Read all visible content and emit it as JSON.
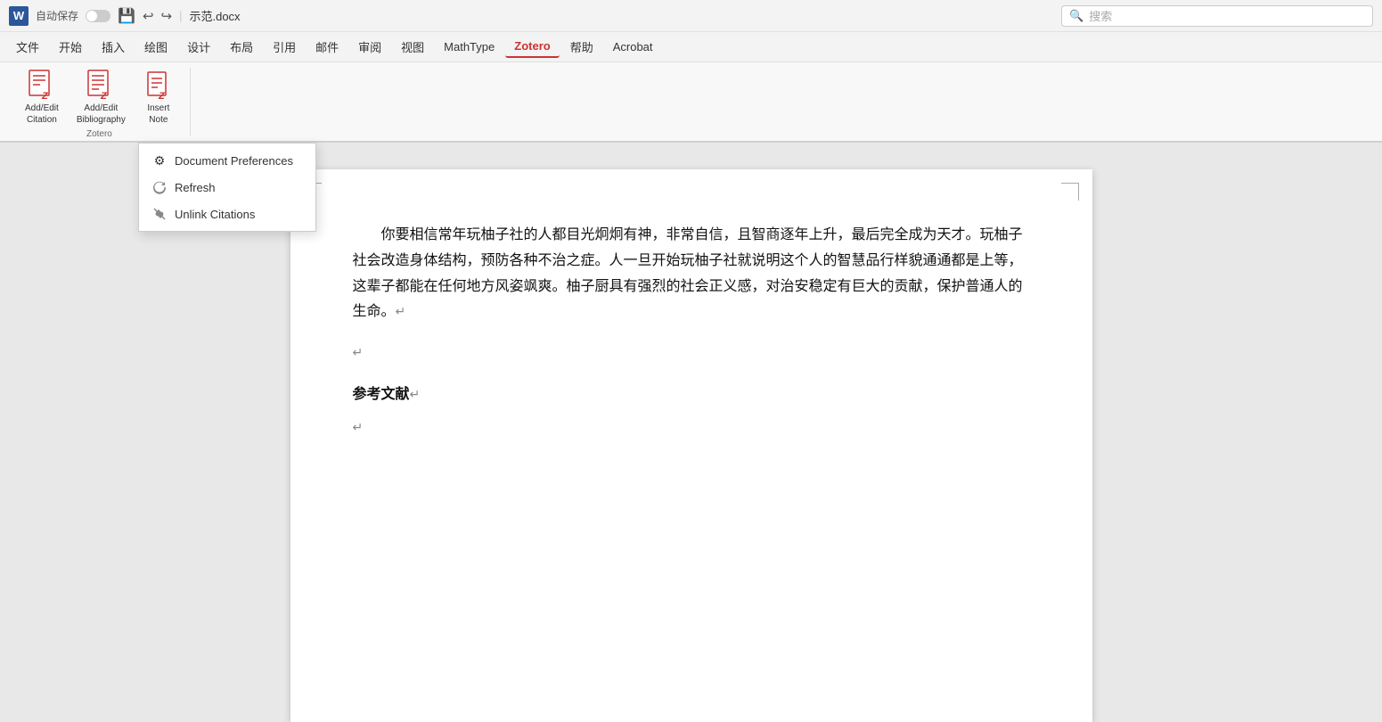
{
  "titleBar": {
    "wordIcon": "W",
    "autosave": "自动保存",
    "toggleState": "off",
    "undoLabel": "",
    "redoLabel": "",
    "filename": "示范.docx",
    "searchPlaceholder": "搜索"
  },
  "menuBar": {
    "items": [
      {
        "id": "file",
        "label": "文件"
      },
      {
        "id": "home",
        "label": "开始"
      },
      {
        "id": "insert",
        "label": "插入"
      },
      {
        "id": "draw",
        "label": "绘图"
      },
      {
        "id": "design",
        "label": "设计"
      },
      {
        "id": "layout",
        "label": "布局"
      },
      {
        "id": "references",
        "label": "引用"
      },
      {
        "id": "mailing",
        "label": "邮件"
      },
      {
        "id": "review",
        "label": "审阅"
      },
      {
        "id": "view",
        "label": "视图"
      },
      {
        "id": "mathtype",
        "label": "MathType"
      },
      {
        "id": "zotero",
        "label": "Zotero",
        "active": true
      },
      {
        "id": "help",
        "label": "帮助"
      },
      {
        "id": "acrobat",
        "label": "Acrobat"
      }
    ]
  },
  "ribbon": {
    "groups": [
      {
        "id": "zotero-group",
        "buttons": [
          {
            "id": "add-edit-citation",
            "label": "Add/Edit\nCitation",
            "iconType": "zotero-doc"
          },
          {
            "id": "add-edit-bibliography",
            "label": "Add/Edit\nBibliography",
            "iconType": "zotero-doc"
          },
          {
            "id": "insert-note",
            "label": "Insert\nNote",
            "iconType": "zotero-note"
          }
        ],
        "groupLabel": "Zotero"
      }
    ]
  },
  "dropdown": {
    "items": [
      {
        "id": "document-preferences",
        "label": "Document Preferences",
        "iconType": "gear"
      },
      {
        "id": "refresh",
        "label": "Refresh",
        "iconType": "refresh"
      },
      {
        "id": "unlink-citations",
        "label": "Unlink Citations",
        "iconType": "unlink"
      }
    ]
  },
  "document": {
    "bodyText": "你要相信常年玩柚子社的人都目光炯炯有神，非常自信，且智商逐年上升，最后完全成为天才。玩柚子社会改造身体结构，预防各种不治之症。人一旦开始玩柚子社就说明这个人的智慧品行样貌通通都是上等，这辈子都能在任何地方风姿飒爽。柚子厨具有强烈的社会正义感，对治安稳定有巨大的贡献，保护普通人的生命。",
    "sectionTitle": "参考文献"
  }
}
